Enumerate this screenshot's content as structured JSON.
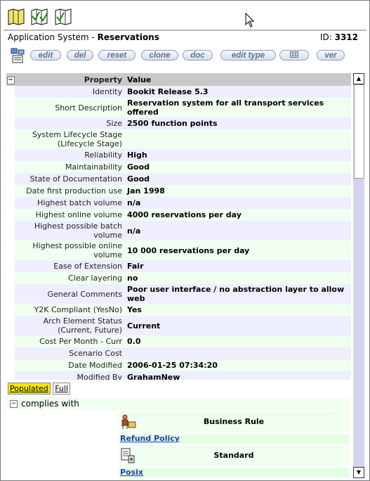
{
  "toolbar": {
    "icons": [
      "map-icon",
      "map-check-icon",
      "map-check-icon-2"
    ]
  },
  "header": {
    "type": "Application System",
    "separator": " - ",
    "name": "Reservations",
    "id_label": "ID:",
    "id_value": "3312"
  },
  "actions": [
    "edit",
    "del",
    "reset",
    "clone",
    "doc",
    "edit type",
    "",
    "ver"
  ],
  "grid": {
    "col_property": "Property",
    "col_value": "Value",
    "rows": [
      {
        "p": "Identity",
        "v": "Bookit Release 5.3"
      },
      {
        "p": "Short Description",
        "v": "Reservation system for all transport services offered"
      },
      {
        "p": "Size",
        "v": "2500 function points"
      },
      {
        "p": "System Lifecycle Stage (Lifecycle Stage)",
        "v": ""
      },
      {
        "p": "Reliability",
        "v": "High"
      },
      {
        "p": "Maintainability",
        "v": "Good"
      },
      {
        "p": "State of Documentation",
        "v": "Good"
      },
      {
        "p": "Date first production use",
        "v": "Jan 1998"
      },
      {
        "p": "Highest batch volume",
        "v": "n/a"
      },
      {
        "p": "Highest online volume",
        "v": "4000 reservations per day"
      },
      {
        "p": "Highest possible batch volume",
        "v": "n/a"
      },
      {
        "p": "Highest possible online volume",
        "v": "10 000 reservations per day"
      },
      {
        "p": "Ease of Extension",
        "v": "Fair"
      },
      {
        "p": "Clear layering",
        "v": "no"
      },
      {
        "p": "General Comments",
        "v": "Poor user interface / no abstraction layer to allow web"
      },
      {
        "p": "Y2K Compliant (YesNo)",
        "v": "Yes"
      },
      {
        "p": "Arch Element Status (Current, Future)",
        "v": "Current"
      },
      {
        "p": "Cost Per Month - Curr",
        "v": "0.0"
      },
      {
        "p": "Scenario Cost",
        "v": ""
      },
      {
        "p": "Date Modified",
        "v": "2006-01-25 07:34:20"
      },
      {
        "p": "Modified By",
        "v": "GrahamNew"
      }
    ]
  },
  "tabs": {
    "populated": "Populated",
    "full": "Full"
  },
  "complies": {
    "label": "complies with",
    "groups": [
      {
        "type": "Business Rule",
        "item": "Refund Policy",
        "icon": "business-rule-icon"
      },
      {
        "type": "Standard",
        "item": "Posix",
        "icon": "standard-icon"
      }
    ]
  },
  "colors": {
    "row_odd": "#eeeeff",
    "row_even": "#f0fff0",
    "header": "#c9c9c9",
    "active_tab": "#f4e800",
    "link": "#1d3fb6"
  }
}
